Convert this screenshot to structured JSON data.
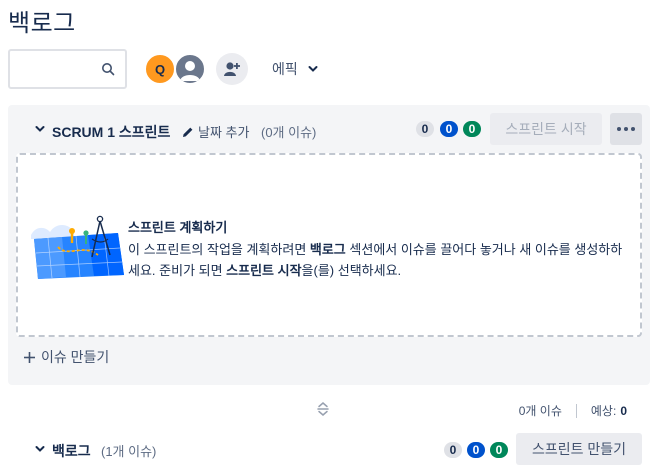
{
  "page": {
    "title": "백로그"
  },
  "toolbar": {
    "search_placeholder": "",
    "avatar_initial": "Q",
    "epic_label": "에픽"
  },
  "sprint": {
    "name": "SCRUM 1 스프린트",
    "add_date_label": "날짜 추가",
    "issue_count": "(0개 이슈)",
    "status_counts": {
      "todo": "0",
      "in_progress": "0",
      "done": "0"
    },
    "start_button": "스프린트 시작",
    "empty_state": {
      "title": "스프린트 계획하기",
      "text_1": "이 스프린트의 작업을 계획하려면 ",
      "text_bold_1": "백로그",
      "text_2": " 섹션에서 이슈를 끌어다 놓거나 새 이슈를 생성하하세요. 준비가 되면 ",
      "text_bold_2": "스프린트 시작",
      "text_3": "을(를) 선택하세요."
    },
    "create_issue": "이슈 만들기"
  },
  "summary": {
    "issues": "0개 이슈",
    "estimate_label": "예상:",
    "estimate_value": "0"
  },
  "backlog": {
    "name": "백로그",
    "issue_count": "(1개 이슈)",
    "status_counts": {
      "todo": "0",
      "in_progress": "0",
      "done": "0"
    },
    "create_sprint_button": "스프린트 만들기"
  },
  "colors": {
    "avatar_q": "#ff991f",
    "in_progress": "#0052cc",
    "done": "#00875a"
  }
}
